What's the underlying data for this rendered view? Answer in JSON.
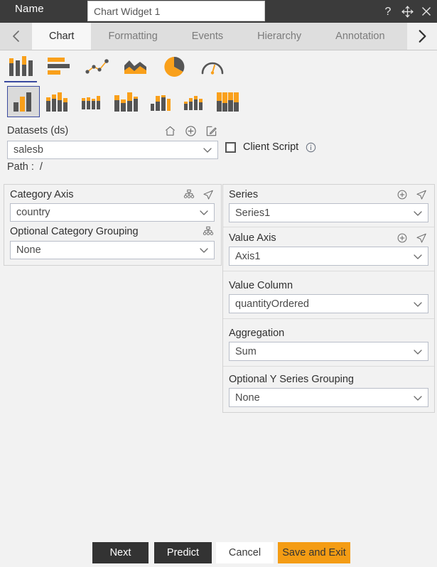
{
  "window": {
    "title_label": "Name",
    "name_value": "Chart Widget 1",
    "name_placeholder": "Name",
    "icons": {
      "help": "help-icon",
      "move": "move-icon",
      "close": "close-icon"
    }
  },
  "tabbar": {
    "prev_arrow": "chevron-left-icon",
    "next_arrow": "chevron-right-icon",
    "tabs": [
      {
        "label": "Chart",
        "active": true
      },
      {
        "label": "Formatting",
        "active": false
      },
      {
        "label": "Events",
        "active": false
      },
      {
        "label": "Hierarchy",
        "active": false
      },
      {
        "label": "Annotation",
        "active": false
      }
    ]
  },
  "chart_types": {
    "row1": [
      {
        "name": "column-chart-icon",
        "selected": true
      },
      {
        "name": "bar-chart-icon",
        "selected": false
      },
      {
        "name": "line-scatter-chart-icon",
        "selected": false
      },
      {
        "name": "area-chart-icon",
        "selected": false
      },
      {
        "name": "pie-chart-icon",
        "selected": false
      },
      {
        "name": "gauge-chart-icon",
        "selected": false
      }
    ],
    "row2": [
      {
        "name": "column-simple-icon",
        "selected": true
      },
      {
        "name": "column-grouped-icon",
        "selected": false
      },
      {
        "name": "column-small-multiples-icon",
        "selected": false
      },
      {
        "name": "column-stacked-icon",
        "selected": false
      },
      {
        "name": "column-mixed-icon",
        "selected": false
      },
      {
        "name": "column-clustered-icon",
        "selected": false
      },
      {
        "name": "column-full-stacked-icon",
        "selected": false
      }
    ]
  },
  "datasets": {
    "label": "Datasets (ds)",
    "icons": [
      {
        "name": "home-icon"
      },
      {
        "name": "add-icon"
      },
      {
        "name": "edit-icon"
      }
    ],
    "value": "salesb",
    "path_label": "Path :",
    "path_value": "/"
  },
  "client_script": {
    "label": "Client Script",
    "checked": false,
    "info_icon": "info-icon"
  },
  "left_panel": {
    "category_axis": {
      "label": "Category Axis",
      "value": "country",
      "icons": [
        "hierarchy-icon",
        "send-icon"
      ]
    },
    "optional_category_grouping": {
      "label": "Optional Category Grouping",
      "value": "None",
      "icons": [
        "hierarchy-icon"
      ]
    }
  },
  "right_panel": {
    "series": {
      "label": "Series",
      "value": "Series1",
      "icons": [
        "add-icon",
        "send-icon"
      ]
    },
    "value_axis": {
      "label": "Value Axis",
      "value": "Axis1",
      "icons": [
        "add-icon",
        "send-icon"
      ]
    },
    "value_column": {
      "label": "Value Column",
      "value": "quantityOrdered"
    },
    "aggregation": {
      "label": "Aggregation",
      "value": "Sum"
    },
    "optional_y_series_grouping": {
      "label": "Optional Y Series Grouping",
      "value": "None"
    }
  },
  "footer": {
    "next": "Next",
    "predict": "Predict",
    "cancel": "Cancel",
    "save_and_exit": "Save and Exit"
  },
  "colors": {
    "titlebar": "#3b3b3b",
    "accent_orange": "#F49C14",
    "chart_orange": "#F9A01B",
    "chart_gray": "#555555",
    "selection_blue": "#3A4AA0",
    "page_bg": "#F2F2F2"
  }
}
